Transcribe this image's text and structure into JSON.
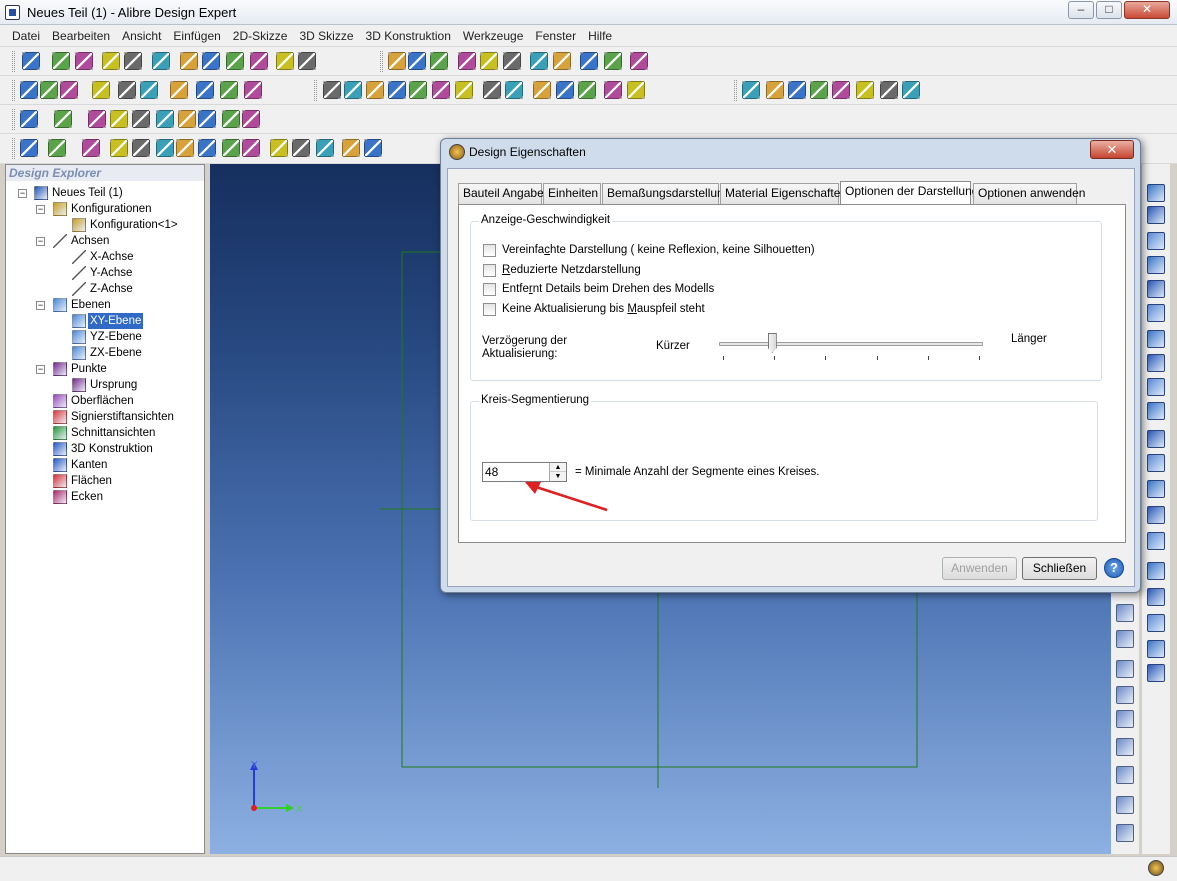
{
  "window": {
    "title": "Neues Teil (1) - Alibre Design Expert",
    "buttons": {
      "minimize": "–",
      "maximize": "□",
      "close": "✕"
    }
  },
  "menu": [
    "Datei",
    "Bearbeiten",
    "Ansicht",
    "Einfügen",
    "2D-Skizze",
    "3D Skizze",
    "3D Konstruktion",
    "Werkzeuge",
    "Fenster",
    "Hilfe"
  ],
  "explorer": {
    "header": "Design Explorer",
    "items": [
      {
        "label": "Neues Teil (1)",
        "icon": "part-icon"
      },
      {
        "label": "Konfigurationen",
        "icon": "table-icon"
      },
      {
        "label": "Konfiguration<1>",
        "icon": "table-icon"
      },
      {
        "label": "Achsen",
        "icon": "axis-icon"
      },
      {
        "label": "X-Achse",
        "icon": "axis-icon"
      },
      {
        "label": "Y-Achse",
        "icon": "axis-icon"
      },
      {
        "label": "Z-Achse",
        "icon": "axis-icon"
      },
      {
        "label": "Ebenen",
        "icon": "plane-icon"
      },
      {
        "label": "XY-Ebene",
        "icon": "plane-icon",
        "selected": true
      },
      {
        "label": "YZ-Ebene",
        "icon": "plane-icon"
      },
      {
        "label": "ZX-Ebene",
        "icon": "plane-icon"
      },
      {
        "label": "Punkte",
        "icon": "point-icon"
      },
      {
        "label": "Ursprung",
        "icon": "point-icon"
      },
      {
        "label": "Oberflächen",
        "icon": "surface-icon"
      },
      {
        "label": "Signierstiftansichten",
        "icon": "redline-icon"
      },
      {
        "label": "Schnittansichten",
        "icon": "section-icon"
      },
      {
        "label": "3D Konstruktion",
        "icon": "construction-icon"
      },
      {
        "label": "Kanten",
        "icon": "edge-icon"
      },
      {
        "label": "Flächen",
        "icon": "face-icon"
      },
      {
        "label": "Ecken",
        "icon": "vertex-icon"
      }
    ]
  },
  "viewport": {
    "triad": {
      "x": "X",
      "y": "Y"
    }
  },
  "dialog": {
    "title": "Design Eigenschaften",
    "close": "✕",
    "tabs": [
      "Bauteil Angaben",
      "Einheiten",
      "Bemaßungsdarstellung",
      "Material Eigenschaften",
      "Optionen der Darstellung",
      "Optionen anwenden"
    ],
    "active_tab": "Optionen der Darstellung",
    "group_speed": {
      "title": "Anzeige-Geschwindigkeit",
      "checkboxes": [
        {
          "pre": "Vereinfa",
          "u": "c",
          "post": "hte Darstellung ( keine Reflexion, keine Silhouetten)",
          "checked": false
        },
        {
          "pre": "",
          "u": "R",
          "post": "eduzierte Netzdarstellung",
          "checked": false
        },
        {
          "pre": "Entfe",
          "u": "r",
          "post": "nt Details beim Drehen des Modells",
          "checked": false
        },
        {
          "pre": "Keine Aktualisierung bis ",
          "u": "M",
          "post": "auspfeil steht",
          "checked": false
        }
      ],
      "slider": {
        "label_line1": "Verzögerung der",
        "label_line2": "Aktualisierung:",
        "min_label": "Kürzer",
        "max_label": "Länger",
        "value": 0.2,
        "ticks": 6
      }
    },
    "group_segments": {
      "title": "Kreis-Segmentierung",
      "value": "48",
      "description": "= Minimale Anzahl der Segmente eines Kreises."
    },
    "buttons": {
      "apply": "Anwenden",
      "close": "Schließen",
      "help": "?"
    }
  },
  "colors": {
    "accent_red": "#e02020",
    "selection": "#3169c6",
    "sketch_green": "#1e7a1e"
  }
}
